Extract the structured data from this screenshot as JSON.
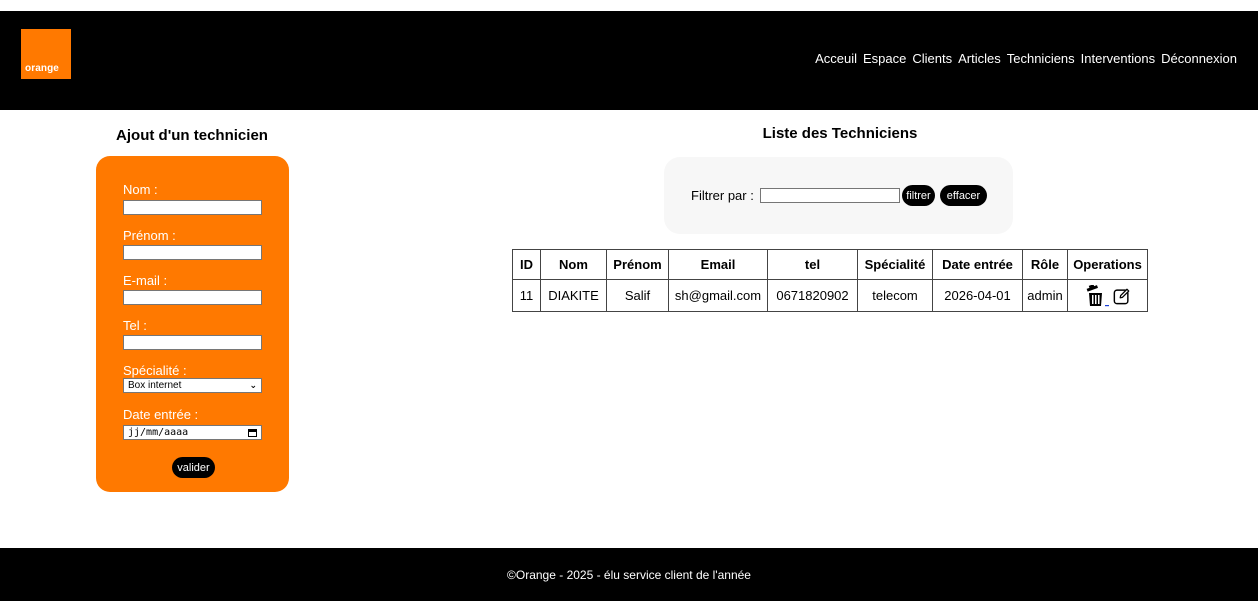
{
  "logo": {
    "text": "orange"
  },
  "nav": [
    "Acceuil",
    "Espace",
    "Clients",
    "Articles",
    "Techniciens",
    "Interventions",
    "Déconnexion"
  ],
  "form": {
    "title": "Ajout d'un technicien",
    "fields": {
      "nom": "Nom :",
      "prenom": "Prénom :",
      "email": "E-mail :",
      "tel": "Tel :",
      "specialite": "Spécialité :",
      "date": "Date entrée :"
    },
    "specialite_value": "Box internet",
    "date_placeholder": "jj/mm/aaaa",
    "submit_label": "valider"
  },
  "list": {
    "title": "Liste des Techniciens",
    "filter_label": "Filtrer par :",
    "filter_button": "filtrer",
    "clear_button": "effacer",
    "columns": [
      "ID",
      "Nom",
      "Prénom",
      "Email",
      "tel",
      "Spécialité",
      "Date entrée",
      "Rôle",
      "Operations"
    ],
    "rows": [
      [
        "11",
        "DIAKITE",
        "Salif",
        "sh@gmail.com",
        "0671820902",
        "telecom",
        "2026-04-01",
        "admin"
      ]
    ]
  },
  "footer": "©Orange - 2025 - élu service client de l'année",
  "colors": {
    "brand": "#ff7900",
    "bar": "#000000"
  }
}
